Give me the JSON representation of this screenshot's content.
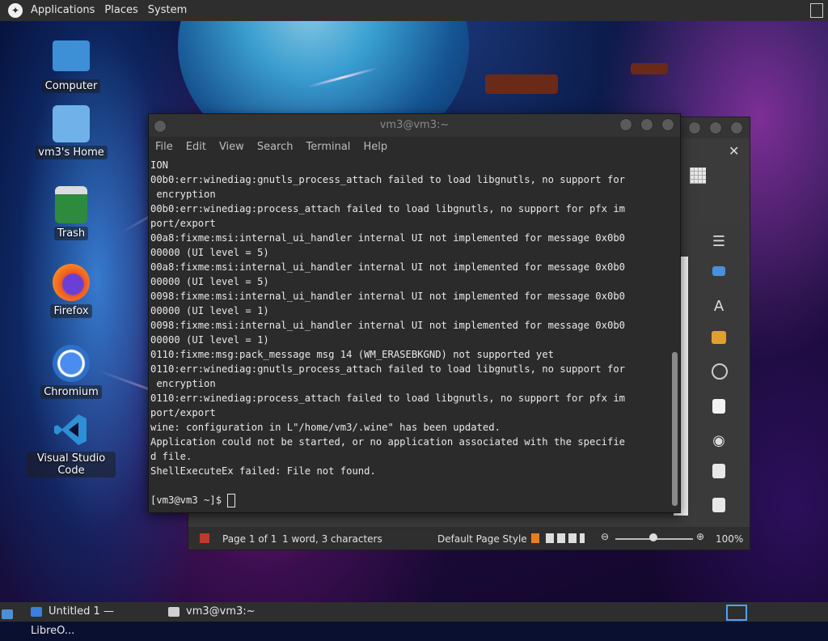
{
  "top_panel": {
    "menus": [
      "Applications",
      "Places",
      "System"
    ]
  },
  "desktop_icons": [
    {
      "label": "Computer",
      "icon": "computer-icon",
      "color": "#3d8fd6"
    },
    {
      "label": "vm3's Home",
      "icon": "home-folder-icon",
      "color": "#6fb1e8"
    },
    {
      "label": "Trash",
      "icon": "trash-icon",
      "color": "#2e8b3e"
    },
    {
      "label": "Firefox",
      "icon": "firefox-icon",
      "color": "#e86a1d"
    },
    {
      "label": "Chromium",
      "icon": "chromium-icon",
      "color": "#3b7fe0"
    },
    {
      "label": "Visual Studio Code",
      "icon": "vscode-icon",
      "color": "#2d8fd5"
    }
  ],
  "terminal": {
    "title": "vm3@vm3:~",
    "menu": [
      "File",
      "Edit",
      "View",
      "Search",
      "Terminal",
      "Help"
    ],
    "lines": [
      "ION",
      "00b0:err:winediag:gnutls_process_attach failed to load libgnutls, no support for",
      " encryption",
      "00b0:err:winediag:process_attach failed to load libgnutls, no support for pfx im",
      "port/export",
      "00a8:fixme:msi:internal_ui_handler internal UI not implemented for message 0x0b0",
      "00000 (UI level = 5)",
      "00a8:fixme:msi:internal_ui_handler internal UI not implemented for message 0x0b0",
      "00000 (UI level = 5)",
      "0098:fixme:msi:internal_ui_handler internal UI not implemented for message 0x0b0",
      "00000 (UI level = 1)",
      "0098:fixme:msi:internal_ui_handler internal UI not implemented for message 0x0b0",
      "00000 (UI level = 1)",
      "0110:fixme:msg:pack_message msg 14 (WM_ERASEBKGND) not supported yet",
      "0110:err:winediag:gnutls_process_attach failed to load libgnutls, no support for",
      " encryption",
      "0110:err:winediag:process_attach failed to load libgnutls, no support for pfx im",
      "port/export",
      "wine: configuration in L\"/home/vm3/.wine\" has been updated.",
      "Application could not be started, or no application associated with the specifie",
      "d file.",
      "ShellExecuteEx failed: File not found.",
      ""
    ],
    "prompt": "[vm3@vm3 ~]$ "
  },
  "libreoffice": {
    "status": {
      "page": "Page 1 of 1",
      "words": "1 word, 3 characters",
      "page_style": "Default Page Style",
      "zoom": "100%"
    },
    "sidebar_icons": [
      "menu-icon",
      "properties-icon",
      "styles-icon",
      "gallery-icon",
      "navigator-icon",
      "page-icon",
      "style-inspector-icon",
      "manage-changes-icon",
      "design-icon"
    ]
  },
  "taskbar": {
    "tasks": [
      {
        "label": "Untitled 1 — LibreO...",
        "icon": "writer-icon"
      },
      {
        "label": "vm3@vm3:~",
        "icon": "terminal-icon"
      }
    ]
  }
}
